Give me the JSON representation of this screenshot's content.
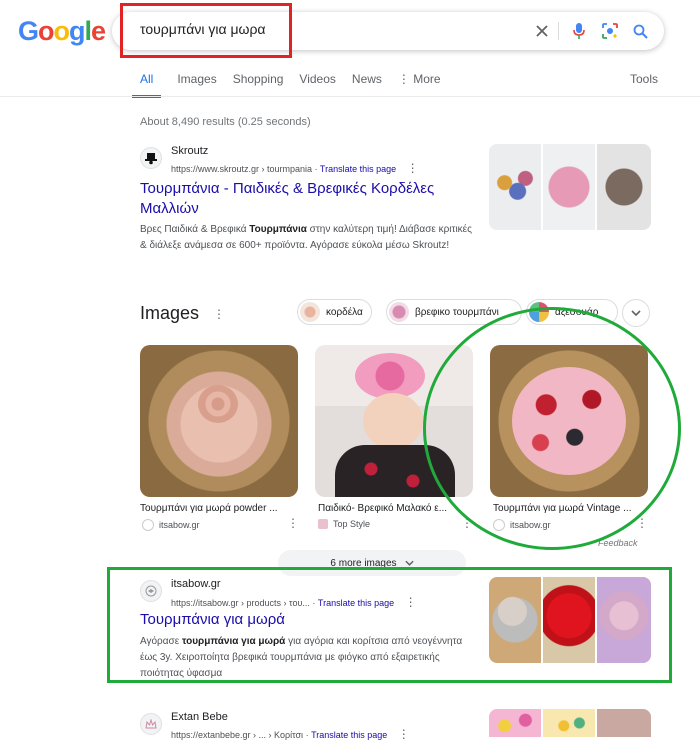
{
  "header": {
    "logo": [
      "G",
      "o",
      "o",
      "g",
      "l",
      "e"
    ],
    "logo_colors": [
      "#4285f4",
      "#ea4335",
      "#fbbc05",
      "#4285f4",
      "#34a853",
      "#ea4335"
    ],
    "search_query": "τουρμπάνι για μωρα"
  },
  "tabs": [
    {
      "label": "All",
      "active": true
    },
    {
      "label": "Images"
    },
    {
      "label": "Shopping"
    },
    {
      "label": "Videos"
    },
    {
      "label": "News"
    },
    {
      "label": "More"
    }
  ],
  "tools_label": "Tools",
  "stats": "About 8,490 results (0.25 seconds)",
  "results": [
    {
      "site": "Skroutz",
      "url": "https://www.skroutz.gr › tourmpania",
      "translate": "Translate this page",
      "title_line1": "Τουρμπάνια - Παιδικές & Βρεφικές Κορδέλες",
      "title_line2": "Μαλλιών",
      "snippet": "Βρες Παιδικά & Βρεφικά Τουρμπάνια στην καλύτερη τιμή! Διάβασε κριτικές & διάλεξε ανάμεσα σε 600+ προϊόντα. Αγόρασε εύκολα μέσω Skroutz!"
    },
    {
      "site": "itsabow.gr",
      "url": "https://itsabow.gr › products › του...",
      "translate": "Translate this page",
      "title_line1": "Τουρμπάνια για μωρά",
      "snippet": "Αγόρασε τουρμπάνια για μωρά για αγόρια και κορίτσια από νεογέννητα έως 3y. Χειροποίητα βρεφικά τουρμπάνια με φιόγκο από εξαιρετικής ποιότητας ύφασμα"
    },
    {
      "site": "Extan Bebe",
      "url": "https://extanbebe.gr › ... › Κορίτσι",
      "translate": "Translate this page"
    }
  ],
  "images_section": {
    "title": "Images",
    "chips": [
      "κορδέλα",
      "βρεφικο τουρμπάνι",
      "αξεσουάρ"
    ],
    "cards": [
      {
        "caption": "Τουρμπάνι για μωρά powder ...",
        "source": "itsabow.gr"
      },
      {
        "caption": "Παιδικό- Βρεφικό Μαλακό ε...",
        "source": "Top Style"
      },
      {
        "caption": "Τουρμπάνι για μωρά Vintage ...",
        "source": "itsabow.gr"
      }
    ],
    "feedback": "Feedback",
    "more_images": "6 more images"
  }
}
